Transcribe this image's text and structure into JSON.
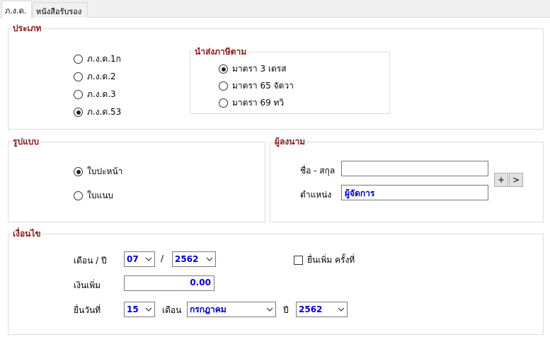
{
  "tabs": [
    {
      "label": "ภ.ง.ด.",
      "active": true
    },
    {
      "label": "หนังสือรับรอง",
      "active": false
    }
  ],
  "type_group": {
    "legend": "ประเภท",
    "options": [
      {
        "label": "ภ.ง.ด.1ก",
        "checked": false
      },
      {
        "label": "ภ.ง.ด.2",
        "checked": false
      },
      {
        "label": "ภ.ง.ด.3",
        "checked": false
      },
      {
        "label": "ภ.ง.ด.53",
        "checked": true
      }
    ],
    "submit_section": {
      "legend": "นำส่งภาษีตาม",
      "options": [
        {
          "label": "มาตรา 3 เตรส",
          "checked": true
        },
        {
          "label": "มาตรา 65 จัตวา",
          "checked": false
        },
        {
          "label": "มาตรา 69 ทวิ",
          "checked": false
        }
      ]
    }
  },
  "format_group": {
    "legend": "รูปแบบ",
    "options": [
      {
        "label": "ใบปะหน้า",
        "checked": true
      },
      {
        "label": "ใบแนบ",
        "checked": false
      }
    ]
  },
  "signer_group": {
    "legend": "ผู้ลงนาม",
    "name_label": "ชื่อ - สกุล",
    "name_value": "",
    "position_label": "ตำแหน่ง",
    "position_value": "ผู้จัดการ",
    "add_label": "+",
    "next_label": ">"
  },
  "conditions_group": {
    "legend": "เงื่อนไข",
    "month_year_label": "เดือน / ปี",
    "month_value": "07",
    "separator": "/",
    "year_value": "2562",
    "additional_filing_label": "ยื่นเพิ่ม ครั้งที่",
    "additional_filing_checked": false,
    "surcharge_label": "เงินเพิ่ม",
    "surcharge_value": "0.00",
    "filing_date_label": "ยื่นวันที่",
    "day_value": "15",
    "month_label": "เดือน",
    "month_name_value": "กรกฎาคม",
    "year_label": "ปี",
    "filing_year_value": "2562"
  },
  "colors": {
    "legend": "#8b1a1a",
    "value_text": "#0000cc",
    "tab_bar": "#f0f0f0"
  }
}
